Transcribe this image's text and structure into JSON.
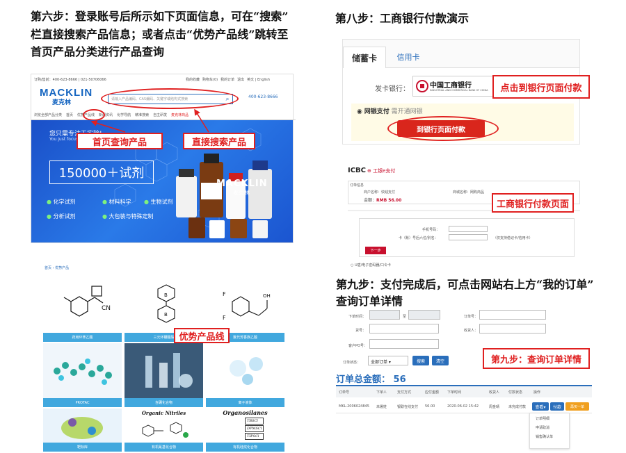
{
  "step6": {
    "heading_line1": "第六步：登录账号后所示如下页面信息，可在“搜索”",
    "heading_line2": "栏直接搜索产品信息；或者点击“优势产品线”跳转至",
    "heading_line3": "首页产品分类进行产品查询",
    "site": {
      "topbar_left": "订购/售前：400-623-8666 | 021-50706066",
      "topbar_right": [
        "我的收藏",
        "购物车(0)",
        "我的订单",
        "退出",
        "英文 | English"
      ],
      "logo_text": "MACKLIN",
      "logo_cn": "麦克林",
      "search_placeholder": "请输入产品编码、CAS编码、关键字或结构式搜索",
      "phone": "400-623-8666",
      "nav": [
        "浏览全部产品分类",
        "首页",
        "优势产品线",
        "新闻资讯",
        "化学导航",
        "精准搜索",
        "自主研发",
        "麦克林商品"
      ],
      "banner_line1": "您只需专注于实验!",
      "banner_line2": "You just focus on experiments.",
      "banner_big": "150000＋试剂",
      "banner_brand": "MACKLIN",
      "banner_brand_cn": "麦克林",
      "features": [
        "化学试剂",
        "材料科学",
        "生物试剂",
        "分析试剂",
        "大包装与特殊定制"
      ],
      "callout_home": "首页查询产品",
      "callout_search": "直接搜索产品"
    },
    "products": {
      "breadcrumb": "首页 › 优势产品",
      "callout": "优势产品线",
      "tiles": [
        "药用环苯乙酸",
        "三元环硼酸酯",
        "氟代芳香族乙酸",
        "PROTAC",
        "含硼化合物",
        "离子液体",
        "靶标库",
        "有机氰基化合物",
        "有机硅烷化合物"
      ],
      "nitriles_title": "Organic Nitriles",
      "silanes_title": "Organosilanes",
      "silane_labels": [
        "TBSCl",
        "DPMSCl",
        "TIPSCl",
        "DMIPSCl"
      ]
    }
  },
  "step8": {
    "heading": "第八步：工商银行付款演示",
    "tabs": [
      "储蓄卡",
      "信用卡"
    ],
    "bank_label": "发卡银行：",
    "bank_name": "中国工商银行",
    "bank_name_en": "INDUSTRIAL AND COMMERCIAL BANK OF CHINA",
    "callout_pay": "点击到银行页面付款",
    "netbank_label": "网银支付",
    "netbank_sub": "需开通网银",
    "pay_button": "到银行页面付款",
    "icbc": {
      "brand": "ICBC",
      "brand_cn": "工银e支付",
      "order_label": "订单信息",
      "merchant_label": "商户名称：",
      "merchant": "快钱支付",
      "mall_label": "商城名称：",
      "mall": "网购商品",
      "amount_label": "金额：",
      "amount": "RMB 56.00",
      "callout": "工商银行付款页面",
      "phone_label": "手机号码：",
      "card_label": "卡（账）号后六位/别名：",
      "hint": "（仅支持借记卡/信用卡）",
      "next_button": "下一步",
      "footer_option": "U盾/电子密码器/口令卡"
    }
  },
  "step9": {
    "heading_line1": "第九步：支付完成后，可点击网站右上方“我的订单”",
    "heading_line2": "查询订单详情",
    "form": {
      "order_time": "下单时间：",
      "to": "至",
      "order_no": "订单号：",
      "goods_no": "货号：",
      "receiver": "收货人：",
      "po_no": "客户PO号：",
      "status_label": "订单状态：",
      "status_value": "全部订单",
      "search_btn": "搜索",
      "reset_btn": "清空"
    },
    "callout": "第九步：查询订单详情",
    "total_label": "订单总金额：",
    "total_value": "56",
    "table": {
      "headers": [
        "订单号",
        "下单人",
        "支付方式",
        "应付金额",
        "下单时间",
        "收货人",
        "付款状态",
        "操作"
      ],
      "row": [
        "MKL-2006024845",
        "未署姓",
        "银联在线支付",
        "56.00",
        "2020-06-02 15:42",
        "周金晴",
        "未完成付款"
      ],
      "actions": [
        "查看▾",
        "付款",
        "再买一单"
      ],
      "dropdown": [
        "订单明细",
        "申请取消",
        "销售确认单"
      ]
    }
  },
  "colors": {
    "accent_red": "#e02020",
    "mack_blue": "#1565c0",
    "tile_blue": "#41a8de",
    "icbc_red": "#c8102e"
  }
}
